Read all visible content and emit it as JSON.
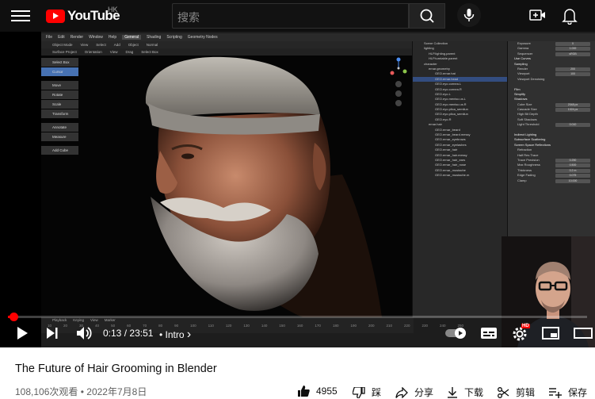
{
  "header": {
    "logo_text": "YouTube",
    "region": "HK",
    "search_placeholder": "搜索"
  },
  "blender": {
    "menubar": [
      "File",
      "Edit",
      "Render",
      "Window",
      "Help",
      "General",
      "Shading",
      "Scripting",
      "Geometry Nodes"
    ],
    "active_workspace": "General",
    "header_items": [
      "Object Mode",
      "View",
      "Select",
      "Add",
      "Object",
      "Normal"
    ],
    "header2_items": [
      "Surface Project",
      "Orientation",
      "View",
      "Drag",
      "Select Box"
    ],
    "tools": [
      "Select Box",
      "Cursor",
      "Move",
      "Rotate",
      "Scale",
      "Transform",
      "Annotate",
      "Measure",
      "Add Cube"
    ],
    "outliner_rows": [
      {
        "label": "Scene Collection",
        "indent": 0,
        "selected": false
      },
      {
        "label": "lighting",
        "indent": 0,
        "selected": false
      },
      {
        "label": "HLP.lighting.parent",
        "indent": 1,
        "selected": false
      },
      {
        "label": "HLP.turntable.parent",
        "indent": 1,
        "selected": false
      },
      {
        "label": "character",
        "indent": 0,
        "selected": false
      },
      {
        "label": "ernar.geometry",
        "indent": 1,
        "selected": false
      },
      {
        "label": "GEO.ernar.hat",
        "indent": 2,
        "selected": false
      },
      {
        "label": "GEO.ernar.head",
        "indent": 2,
        "selected": true
      },
      {
        "label": "GEO.eyo.cornea.L",
        "indent": 2,
        "selected": false
      },
      {
        "label": "GEO.eyo.cornea.R",
        "indent": 2,
        "selected": false
      },
      {
        "label": "GEO.eyo.L",
        "indent": 2,
        "selected": false
      },
      {
        "label": "GEO.eyo.menisc.us.L",
        "indent": 2,
        "selected": false
      },
      {
        "label": "GEO.eyo.menisc.us.R",
        "indent": 2,
        "selected": false
      },
      {
        "label": "GEO.eyo.plica_semilun",
        "indent": 2,
        "selected": false
      },
      {
        "label": "GEO.eyo.plica_semilun",
        "indent": 2,
        "selected": false
      },
      {
        "label": "GEO.eyo.R",
        "indent": 2,
        "selected": false
      },
      {
        "label": "ernar.hair",
        "indent": 1,
        "selected": false
      },
      {
        "label": "GEO.ernar_beard",
        "indent": 2,
        "selected": false
      },
      {
        "label": "GEO.ernar_beard.messy",
        "indent": 2,
        "selected": false
      },
      {
        "label": "GEO.ernar_eyebrows",
        "indent": 2,
        "selected": false
      },
      {
        "label": "GEO.ernar_eyelashes",
        "indent": 2,
        "selected": false
      },
      {
        "label": "GEO.ernar_hair",
        "indent": 2,
        "selected": false
      },
      {
        "label": "GEO.ernar_hair.messy",
        "indent": 2,
        "selected": false
      },
      {
        "label": "GEO.ernar_hair_ears",
        "indent": 2,
        "selected": false
      },
      {
        "label": "GEO.ernar_hair_nose",
        "indent": 2,
        "selected": false
      },
      {
        "label": "GEO.ernar_mustache",
        "indent": 2,
        "selected": false
      },
      {
        "label": "GEO.ernar_mustache.m",
        "indent": 2,
        "selected": false
      }
    ],
    "props_header": {
      "scene": "Scene",
      "view_layer": "View Layer"
    },
    "props_rows": [
      {
        "label": "Exposure",
        "value": "0",
        "section": false
      },
      {
        "label": "Gamma",
        "value": "1.000",
        "section": false
      },
      {
        "label": "Sequencer",
        "value": "sRGB",
        "section": false
      },
      {
        "label": "Use Curves",
        "value": "",
        "section": true
      },
      {
        "label": "Sampling",
        "value": "",
        "section": true
      },
      {
        "label": "Render",
        "value": "200",
        "section": false
      },
      {
        "label": "Viewport",
        "value": "100",
        "section": false
      },
      {
        "label": "Viewport Denoising",
        "value": "",
        "section": false
      },
      {
        "label": "",
        "value": "",
        "section": false
      },
      {
        "label": "Film",
        "value": "",
        "section": true
      },
      {
        "label": "Simplify",
        "value": "",
        "section": true
      },
      {
        "label": "Shadows",
        "value": "",
        "section": true
      },
      {
        "label": "Cube Size",
        "value": "2048 px",
        "section": false
      },
      {
        "label": "Cascade Size",
        "value": "1024 px",
        "section": false
      },
      {
        "label": "High Bit Depth",
        "value": "",
        "section": false
      },
      {
        "label": "Soft Shadows",
        "value": "",
        "section": false
      },
      {
        "label": "Light Threshold",
        "value": "0.010",
        "section": false
      },
      {
        "label": "",
        "value": "",
        "section": false
      },
      {
        "label": "Indirect Lighting",
        "value": "",
        "section": true
      },
      {
        "label": "Subsurface Scattering",
        "value": "",
        "section": true
      },
      {
        "label": "Screen Space Reflections",
        "value": "",
        "section": true
      },
      {
        "label": "Refraction",
        "value": "",
        "section": false
      },
      {
        "label": "Half Res Trace",
        "value": "",
        "section": false
      },
      {
        "label": "Trace Precision",
        "value": "0.250",
        "section": false
      },
      {
        "label": "Max Roughness",
        "value": "0.500",
        "section": false
      },
      {
        "label": "Thickness",
        "value": "0.2 m",
        "section": false
      },
      {
        "label": "Edge Fading",
        "value": "0.075",
        "section": false
      },
      {
        "label": "Clamp",
        "value": "10.000",
        "section": false
      }
    ],
    "timeline_menu": [
      "Playback",
      "Keying",
      "View",
      "Marker"
    ],
    "timeline_ticks": [
      "10",
      "20",
      "30",
      "40",
      "50",
      "60",
      "70",
      "80",
      "90",
      "100",
      "110",
      "120",
      "130",
      "140",
      "150",
      "160",
      "170",
      "180",
      "190",
      "200",
      "210",
      "220",
      "230",
      "240",
      "250"
    ]
  },
  "player": {
    "progress": 0.009,
    "current_time": "0:13",
    "duration": "23:51",
    "time_separator": "/",
    "chapter": "Intro",
    "chapter_arrow": "›",
    "hd_badge": "HD"
  },
  "video": {
    "title": "The Future of Hair Grooming in Blender",
    "views": "108,106次观看",
    "date": "2022年7月8日",
    "meta_separator": "•"
  },
  "actions": {
    "likes": "4955",
    "dislike_label": "踩",
    "share_label": "分享",
    "download_label": "下载",
    "clip_label": "剪辑",
    "save_label": "保存"
  },
  "colors": {
    "accent_red": "#ff0000",
    "blender_select": "#4772b3"
  }
}
